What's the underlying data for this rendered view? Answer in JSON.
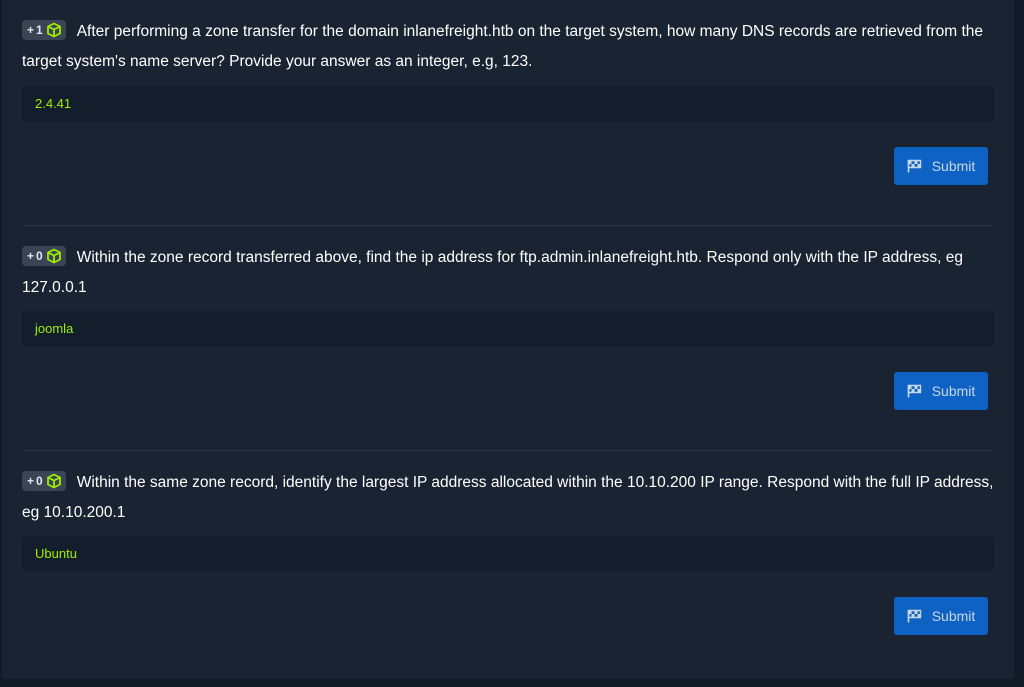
{
  "questions": [
    {
      "points": "1",
      "prefix": "+",
      "text": "After performing a zone transfer for the domain inlanefreight.htb on the target system, how many DNS records are retrieved from the target system's name server? Provide your answer as an integer, e.g, 123.",
      "answer": "2.4.41",
      "submit_label": "Submit"
    },
    {
      "points": "0",
      "prefix": "+",
      "text": "Within the zone record transferred above, find the ip address for ftp.admin.inlanefreight.htb. Respond only with the IP address, eg 127.0.0.1",
      "answer": "joomla",
      "submit_label": "Submit"
    },
    {
      "points": "0",
      "prefix": "+",
      "text": "Within the same zone record, identify the largest IP address allocated within the 10.10.200 IP range. Respond with the full IP address, eg 10.10.200.1",
      "answer": "Ubuntu",
      "submit_label": "Submit"
    }
  ],
  "colors": {
    "answer_text": "#9fef00",
    "cube_icon": "#9fef00",
    "submit_bg": "#0d62c4"
  }
}
